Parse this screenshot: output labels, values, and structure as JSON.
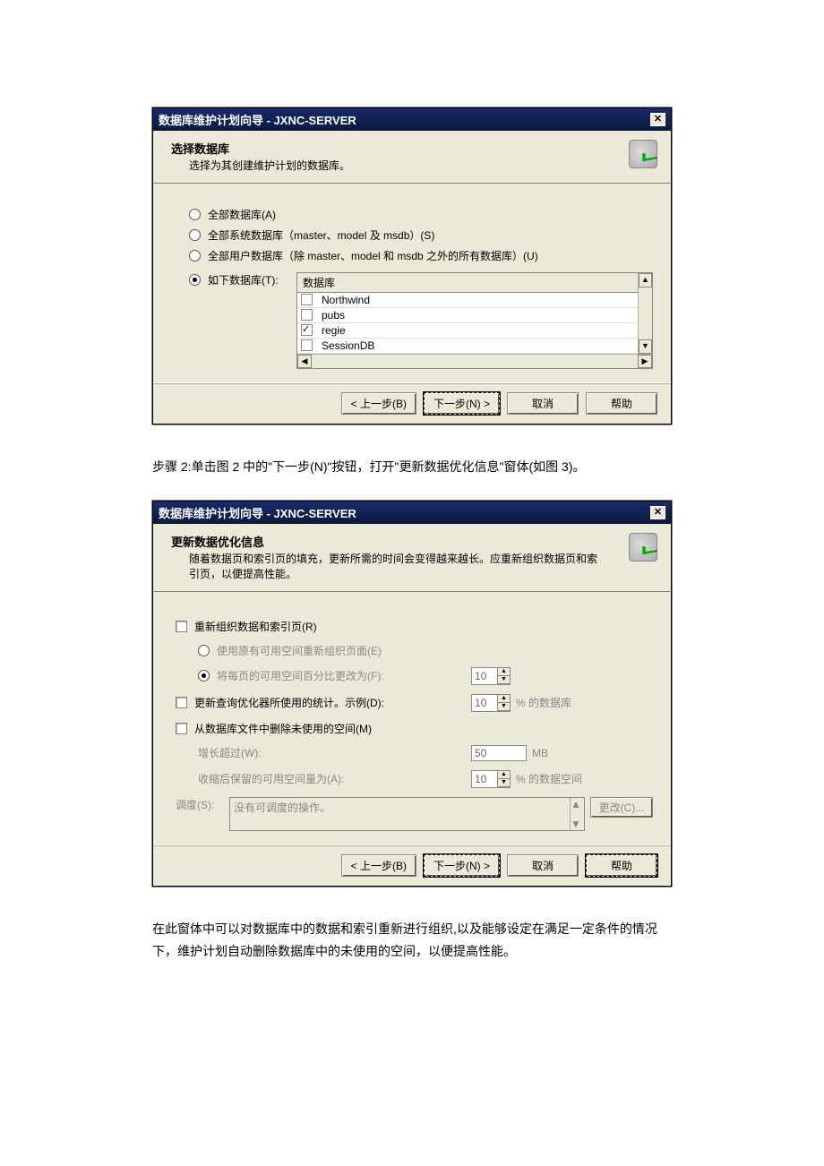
{
  "dialog1": {
    "title": "数据库维护计划向导 - JXNC-SERVER",
    "header_title": "选择数据库",
    "header_sub": "选择为其创建维护计划的数据库。",
    "opt_all": "全部数据库(A)",
    "opt_sys": "全部系统数据库（master、model 及 msdb）(S)",
    "opt_user": "全部用户数据库（除 master、model 和 msdb 之外的所有数据库）(U)",
    "opt_these": "如下数据库(T):",
    "col_header": "数据库",
    "rows": [
      {
        "checked": false,
        "name": "Northwind"
      },
      {
        "checked": false,
        "name": "pubs"
      },
      {
        "checked": true,
        "name": "regie"
      },
      {
        "checked": false,
        "name": "SessionDB"
      }
    ],
    "btn_back": "< 上一步(B)",
    "btn_next": "下一步(N) >",
    "btn_cancel": "取消",
    "btn_help": "帮助"
  },
  "midtext": "步骤 2:单击图 2 中的\"下一步(N)\"按钮，打开\"更新数据优化信息\"窗体(如图 3)。",
  "dialog2": {
    "title": "数据库维护计划向导 - JXNC-SERVER",
    "header_title": "更新数据优化信息",
    "header_sub": "随着数据页和索引页的填充，更新所需的时间会变得越来越长。应重新组织数据页和索引页，以便提高性能。",
    "chk_reorg": "重新组织数据和索引页(R)",
    "opt_reorg_orig": "使用原有可用空间重新组织页面(E)",
    "opt_reorg_pct": "将每页的可用空间百分比更改为(F):",
    "pct_val": "10",
    "chk_stats": "更新查询优化器所使用的统计。示例(D):",
    "stats_val": "10",
    "stats_unit": "% 的数据库",
    "chk_shrink": "从数据库文件中删除未使用的空间(M)",
    "grow_label": "增长超过(W):",
    "grow_val": "50",
    "grow_unit": "MB",
    "retain_label": "收缩后保留的可用空间量为(A):",
    "retain_val": "10",
    "retain_unit": "% 的数据空间",
    "sched_label": "调度(S):",
    "sched_text": "没有可调度的操作。",
    "btn_change": "更改(C)...",
    "btn_back": "< 上一步(B)",
    "btn_next": "下一步(N) >",
    "btn_cancel": "取消",
    "btn_help": "帮助"
  },
  "tailtext": "在此窗体中可以对数据库中的数据和索引重新进行组织,以及能够设定在满足一定条件的情况下，维护计划自动删除数据库中的未使用的空间，以便提高性能。"
}
